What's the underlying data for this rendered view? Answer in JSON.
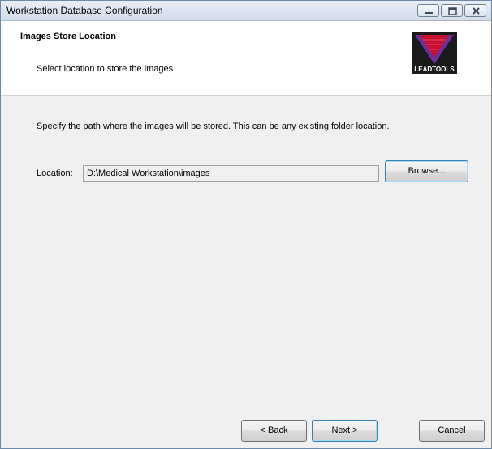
{
  "window": {
    "title": "Workstation Database Configuration"
  },
  "header": {
    "title": "Images Store Location",
    "subtitle": "Select location to store the images",
    "logo_text": "LEADTOOLS"
  },
  "main": {
    "instruction": "Specify the path where the images will be stored.  This can be any existing folder location.",
    "location_label": "Location:",
    "location_value": "D:\\Medical Workstation\\images",
    "browse_label": "Browse..."
  },
  "footer": {
    "back_label": "< Back",
    "next_label": "Next >",
    "cancel_label": "Cancel"
  },
  "colors": {
    "titlebar": "#d2dde9",
    "header_bg": "#ffffff",
    "body_bg": "#f0f0f0",
    "default_button_border": "#3c7fb1",
    "logo_red": "#c8102e",
    "logo_purple": "#6b2fa0"
  }
}
